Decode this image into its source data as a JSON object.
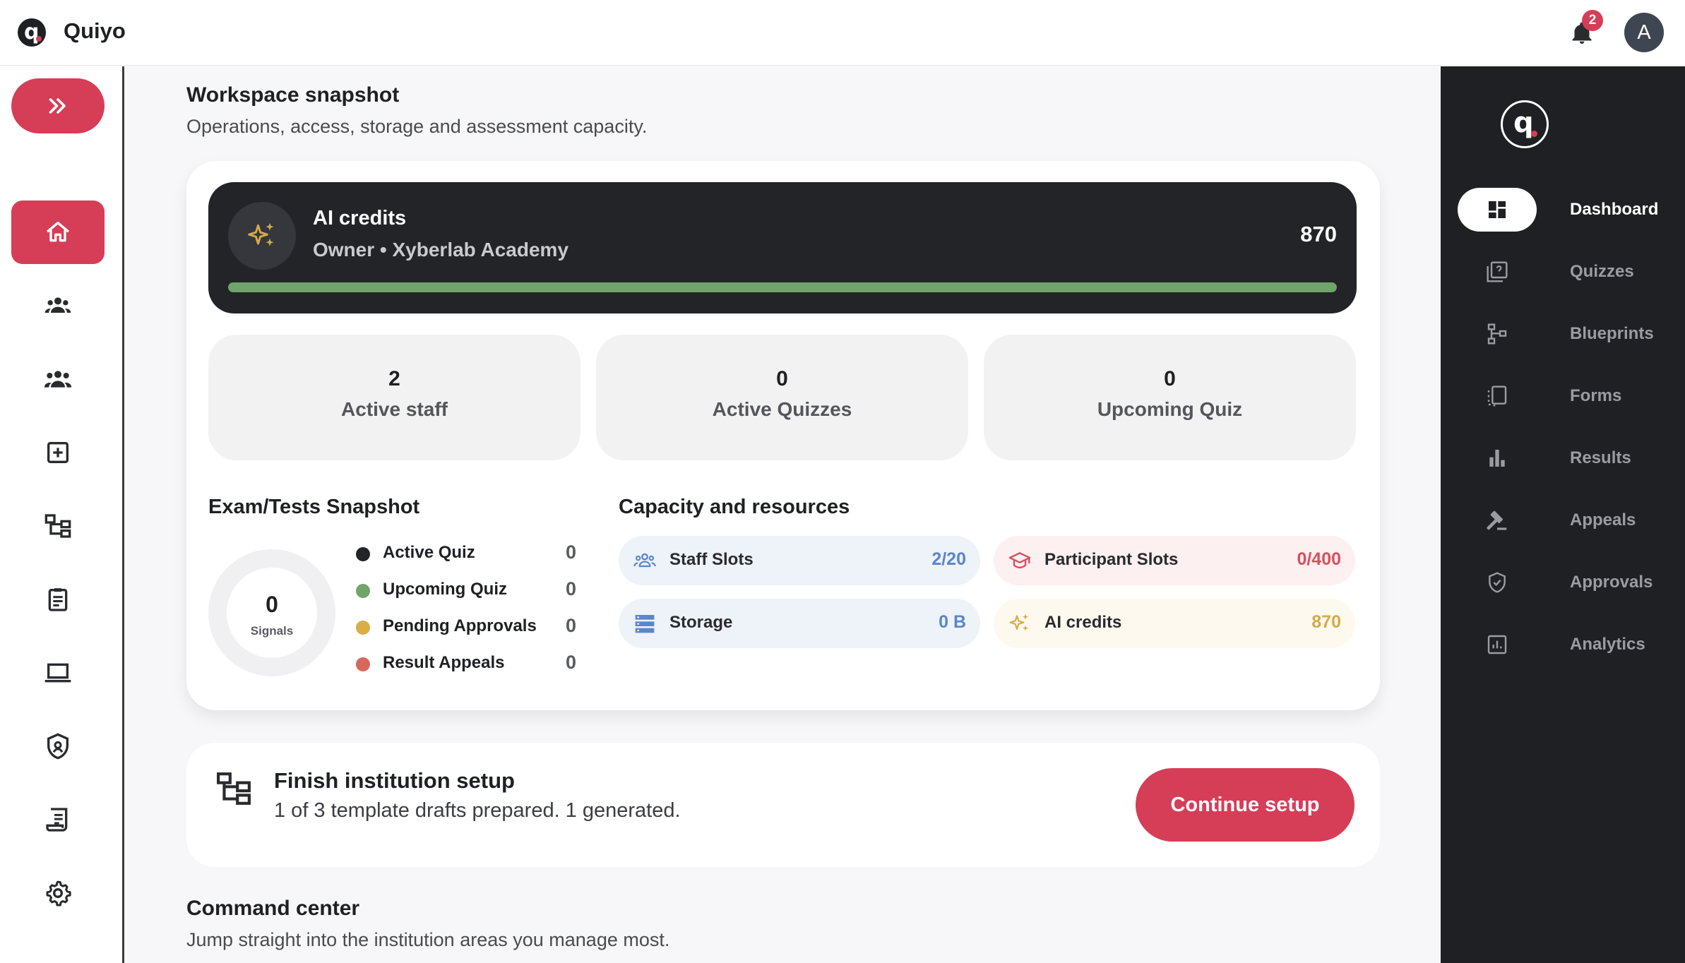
{
  "app": {
    "name": "Quiyo",
    "logo_letter": "q"
  },
  "topbar": {
    "notifications_count": "2",
    "avatar_initial": "A"
  },
  "rail": {
    "icons": [
      "expand-icon",
      "home-icon",
      "users-icon",
      "groups-icon",
      "add-icon",
      "blueprint-icon",
      "clipboard-icon",
      "laptop-icon",
      "shield-icon",
      "receipt-icon",
      "gear-icon"
    ]
  },
  "workspace": {
    "title": "Workspace snapshot",
    "subtitle": "Operations, access, storage and assessment capacity."
  },
  "ai_credits": {
    "title": "AI credits",
    "owner": "Owner • Xyberlab Academy",
    "value": "870",
    "progress": 1.0
  },
  "stats": [
    {
      "value": "2",
      "label": "Active staff"
    },
    {
      "value": "0",
      "label": "Active Quizzes"
    },
    {
      "value": "0",
      "label": "Upcoming Quiz"
    }
  ],
  "exam_snapshot": {
    "title": "Exam/Tests Snapshot",
    "total": "0",
    "total_label": "Signals",
    "items": [
      {
        "name": "Active Quiz",
        "value": "0",
        "color": "#232428"
      },
      {
        "name": "Upcoming Quiz",
        "value": "0",
        "color": "#6fa46a"
      },
      {
        "name": "Pending Approvals",
        "value": "0",
        "color": "#d9ad47"
      },
      {
        "name": "Result Appeals",
        "value": "0",
        "color": "#d8685d"
      }
    ]
  },
  "capacity": {
    "title": "Capacity and resources",
    "items": [
      {
        "name": "Staff Slots",
        "value": "2/20",
        "icon": "users-icon",
        "color": "#5b86c9",
        "bg": "#eef2f9"
      },
      {
        "name": "Participant Slots",
        "value": "0/400",
        "icon": "graduation-cap-icon",
        "color": "#d8505f",
        "bg": "#fdf0f1"
      },
      {
        "name": "Storage",
        "value": "0 B",
        "icon": "storage-icon",
        "color": "#5b86c9",
        "bg": "#eef2f9"
      },
      {
        "name": "AI credits",
        "value": "870",
        "icon": "sparkle-icon",
        "color": "#d4ab4a",
        "bg": "#fdf9ee"
      }
    ]
  },
  "setup": {
    "title": "Finish institution setup",
    "subtitle": "1 of 3 template drafts prepared. 1 generated.",
    "button": "Continue setup"
  },
  "command_center": {
    "title": "Command center",
    "subtitle": "Jump straight into the institution areas you manage most."
  },
  "right_nav": [
    {
      "label": "Dashboard",
      "icon": "dashboard-icon",
      "active": true
    },
    {
      "label": "Quizzes",
      "icon": "quiz-icon",
      "active": false
    },
    {
      "label": "Blueprints",
      "icon": "blueprint-icon",
      "active": false
    },
    {
      "label": "Forms",
      "icon": "forms-icon",
      "active": false
    },
    {
      "label": "Results",
      "icon": "bar-chart-icon",
      "active": false
    },
    {
      "label": "Appeals",
      "icon": "gavel-icon",
      "active": false
    },
    {
      "label": "Approvals",
      "icon": "shield-check-icon",
      "active": false
    },
    {
      "label": "Analytics",
      "icon": "analytics-icon",
      "active": false
    }
  ],
  "colors": {
    "accent": "#d63d57",
    "dark": "#1f2023",
    "progress": "#6fa46a"
  }
}
